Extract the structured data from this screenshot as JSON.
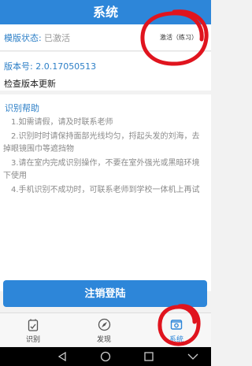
{
  "header": {
    "title": "系统"
  },
  "mode": {
    "label": "模版状态:",
    "value": "已激活",
    "action": "激活（练习）"
  },
  "version": {
    "label": "版本号: 2.0.17050513",
    "check_update": "检查版本更新"
  },
  "help": {
    "title": "识别帮助",
    "items": [
      "1.如需请假，请及时联系老师",
      "2.识别时时请保持面部光线均匀，捋起头发的刘海，去掉眼镜围巾等遮挡物",
      "3.请在室内完成识别操作，不要在室外强光或黑暗环境下使用",
      "4.手机识别不成功时，可联系老师到学校一体机上再试"
    ]
  },
  "logout_label": "注销登陆",
  "tabs": [
    {
      "label": "识别",
      "icon": "recognize-icon"
    },
    {
      "label": "发现",
      "icon": "compass-icon"
    },
    {
      "label": "系统",
      "icon": "system-icon",
      "active": true
    }
  ],
  "colors": {
    "accent": "#2d86d9",
    "annotation": "#e0141e"
  }
}
